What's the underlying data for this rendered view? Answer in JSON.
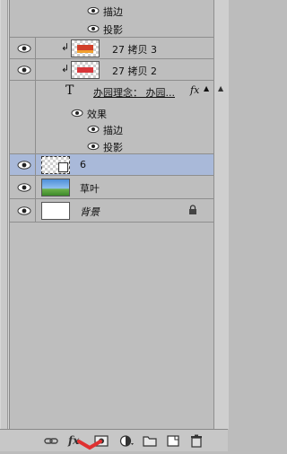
{
  "layers_panel": {
    "top_effects": [
      {
        "label": "描边"
      },
      {
        "label": "投影"
      }
    ],
    "layers": [
      {
        "name": "27 拷贝 3",
        "kind": "image"
      },
      {
        "name": "27 拷贝 2",
        "kind": "image"
      },
      {
        "name": "办园理念：  办园...",
        "kind": "text",
        "fx": "fx",
        "effects_label": "效果",
        "effects": [
          {
            "label": "描边"
          },
          {
            "label": "投影"
          }
        ]
      },
      {
        "name": "6",
        "kind": "smart",
        "selected": true
      },
      {
        "name": "草叶",
        "kind": "image"
      },
      {
        "name": "背景",
        "kind": "background",
        "locked": true
      }
    ]
  },
  "bottom_toolbar": {
    "icons": [
      "link-icon",
      "fx-icon",
      "mask-icon",
      "adjustment-icon",
      "folder-icon",
      "new-layer-icon",
      "trash-icon"
    ],
    "fx_label": "fx"
  },
  "colors": {
    "panel_bg": "#bebebe",
    "selected_row": "#a9b9d9",
    "divider": "#8e8e8e",
    "annotation_red": "#e03030"
  }
}
